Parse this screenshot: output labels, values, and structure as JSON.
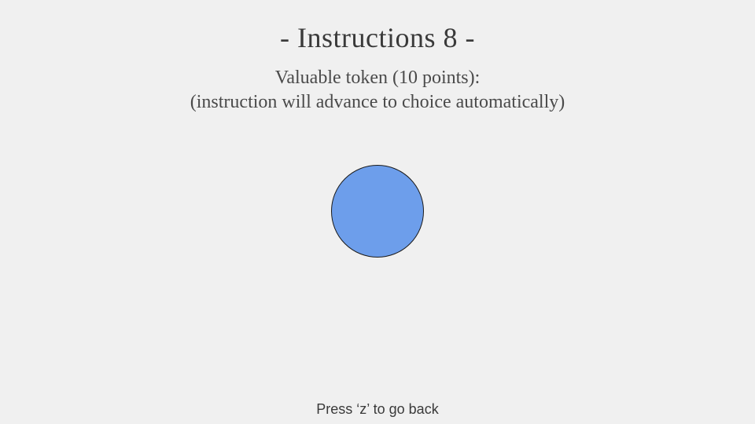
{
  "instructions": {
    "title": "- Instructions 8 -",
    "token_label": "Valuable token (10 points):",
    "note": "(instruction will advance to choice automatically)",
    "back_hint": "Press ‘z’ to go back"
  },
  "token": {
    "icon": "circle-token",
    "fill_color": "#6d9eeb",
    "stroke_color": "#1a1a1a"
  }
}
